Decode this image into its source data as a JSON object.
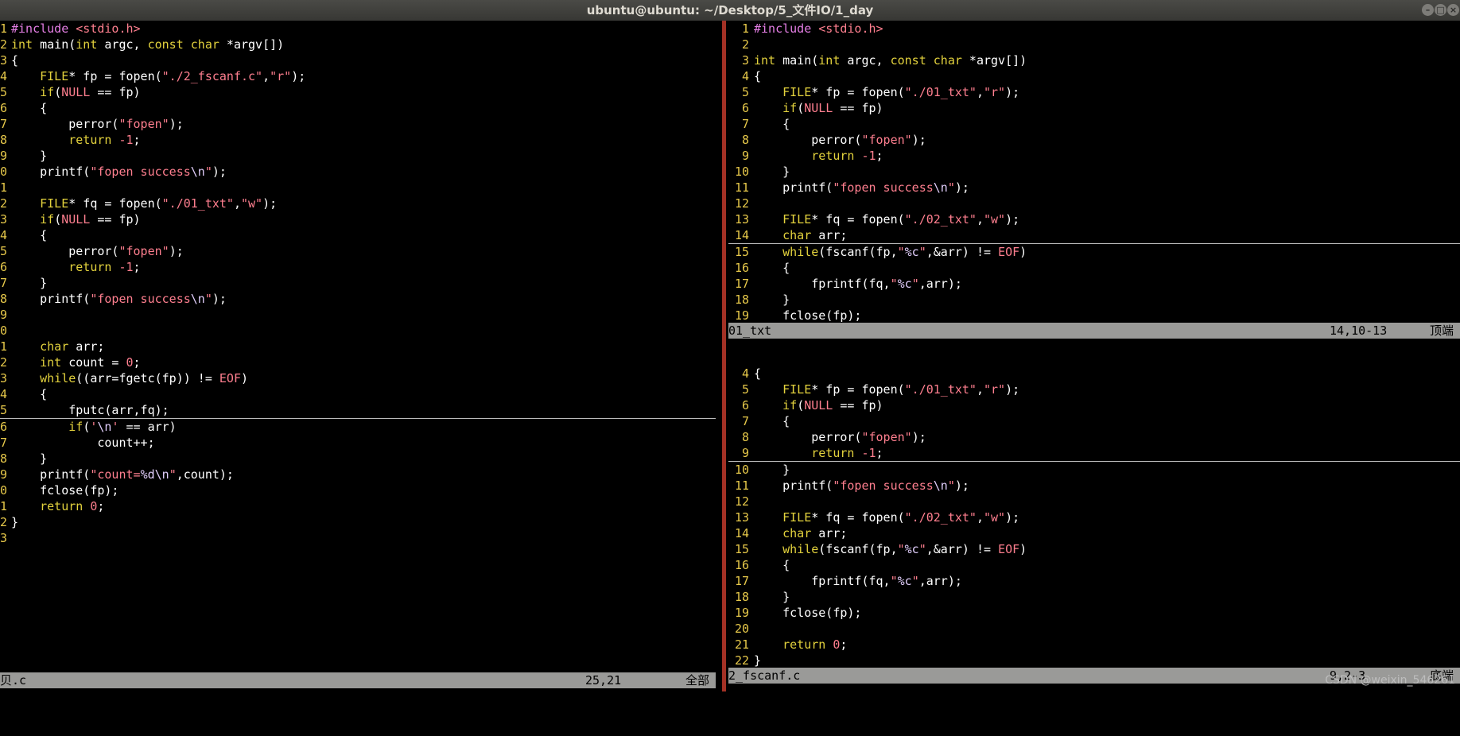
{
  "window": {
    "title": "ubuntu@ubuntu: ~/Desktop/5_文件IO/1_day",
    "controls": [
      "–",
      "□",
      "×"
    ]
  },
  "left_pane": {
    "lines": [
      {
        "n": "1",
        "t": "#include <stdio.h>"
      },
      {
        "n": "2",
        "t": "int main(int argc, const char *argv[])"
      },
      {
        "n": "3",
        "t": "{"
      },
      {
        "n": "4",
        "t": "    FILE* fp = fopen(\"./2_fscanf.c\",\"r\");"
      },
      {
        "n": "5",
        "t": "    if(NULL == fp)"
      },
      {
        "n": "6",
        "t": "    {"
      },
      {
        "n": "7",
        "t": "        perror(\"fopen\");"
      },
      {
        "n": "8",
        "t": "        return -1;"
      },
      {
        "n": "9",
        "t": "    }"
      },
      {
        "n": "0",
        "t": "    printf(\"fopen success\\n\");"
      },
      {
        "n": "1",
        "t": ""
      },
      {
        "n": "2",
        "t": "    FILE* fq = fopen(\"./01_txt\",\"w\");"
      },
      {
        "n": "3",
        "t": "    if(NULL == fp)"
      },
      {
        "n": "4",
        "t": "    {"
      },
      {
        "n": "5",
        "t": "        perror(\"fopen\");"
      },
      {
        "n": "6",
        "t": "        return -1;"
      },
      {
        "n": "7",
        "t": "    }"
      },
      {
        "n": "8",
        "t": "    printf(\"fopen success\\n\");"
      },
      {
        "n": "9",
        "t": ""
      },
      {
        "n": "0",
        "t": ""
      },
      {
        "n": "1",
        "t": "    char arr;"
      },
      {
        "n": "2",
        "t": "    int count = 0;"
      },
      {
        "n": "3",
        "t": "    while((arr=fgetc(fp)) != EOF)"
      },
      {
        "n": "4",
        "t": "    {"
      },
      {
        "n": "5",
        "t": "        fputc(arr,fq);"
      },
      {
        "n": "6",
        "t": "        if('\\n' == arr)"
      },
      {
        "n": "7",
        "t": "            count++;"
      },
      {
        "n": "8",
        "t": "    }"
      },
      {
        "n": "9",
        "t": "    printf(\"count=%d\\n\",count);"
      },
      {
        "n": "0",
        "t": "    fclose(fp);"
      },
      {
        "n": "1",
        "t": "    return 0;"
      },
      {
        "n": "2",
        "t": "}"
      },
      {
        "n": "3",
        "t": ""
      }
    ],
    "status": {
      "file": "贝.c",
      "pos": "25,21",
      "scroll": "全部"
    }
  },
  "right_top_pane": {
    "lines": [
      {
        "n": "1",
        "t": "#include <stdio.h>"
      },
      {
        "n": "2",
        "t": ""
      },
      {
        "n": "3",
        "t": "int main(int argc, const char *argv[])"
      },
      {
        "n": "4",
        "t": "{"
      },
      {
        "n": "5",
        "t": "    FILE* fp = fopen(\"./01_txt\",\"r\");"
      },
      {
        "n": "6",
        "t": "    if(NULL == fp)"
      },
      {
        "n": "7",
        "t": "    {"
      },
      {
        "n": "8",
        "t": "        perror(\"fopen\");"
      },
      {
        "n": "9",
        "t": "        return -1;"
      },
      {
        "n": "10",
        "t": "    }"
      },
      {
        "n": "11",
        "t": "    printf(\"fopen success\\n\");"
      },
      {
        "n": "12",
        "t": ""
      },
      {
        "n": "13",
        "t": "    FILE* fq = fopen(\"./02_txt\",\"w\");"
      },
      {
        "n": "14",
        "t": "    char arr;"
      },
      {
        "n": "15",
        "t": "    while(fscanf(fp,\"%c\",&arr) != EOF)"
      },
      {
        "n": "16",
        "t": "    {"
      },
      {
        "n": "17",
        "t": "        fprintf(fq,\"%c\",arr);"
      },
      {
        "n": "18",
        "t": "    }"
      },
      {
        "n": "19",
        "t": "    fclose(fp);"
      }
    ],
    "status": {
      "file": "01_txt",
      "pos": "14,10-13",
      "scroll": "顶端"
    }
  },
  "right_bottom_pane": {
    "lines": [
      {
        "n": "4",
        "t": "{"
      },
      {
        "n": "5",
        "t": "    FILE* fp = fopen(\"./01_txt\",\"r\");"
      },
      {
        "n": "6",
        "t": "    if(NULL == fp)"
      },
      {
        "n": "7",
        "t": "    {"
      },
      {
        "n": "8",
        "t": "        perror(\"fopen\");"
      },
      {
        "n": "9",
        "t": "        return -1;"
      },
      {
        "n": "10",
        "t": "    }"
      },
      {
        "n": "11",
        "t": "    printf(\"fopen success\\n\");"
      },
      {
        "n": "12",
        "t": ""
      },
      {
        "n": "13",
        "t": "    FILE* fq = fopen(\"./02_txt\",\"w\");"
      },
      {
        "n": "14",
        "t": "    char arr;"
      },
      {
        "n": "15",
        "t": "    while(fscanf(fp,\"%c\",&arr) != EOF)"
      },
      {
        "n": "16",
        "t": "    {"
      },
      {
        "n": "17",
        "t": "        fprintf(fq,\"%c\",arr);"
      },
      {
        "n": "18",
        "t": "    }"
      },
      {
        "n": "19",
        "t": "    fclose(fp);"
      },
      {
        "n": "20",
        "t": ""
      },
      {
        "n": "21",
        "t": "    return 0;"
      },
      {
        "n": "22",
        "t": "}"
      }
    ],
    "status": {
      "file": "2_fscanf.c",
      "pos": "9,2-3",
      "scroll": "底端"
    }
  },
  "watermark": "CSDN @weixin_546261"
}
